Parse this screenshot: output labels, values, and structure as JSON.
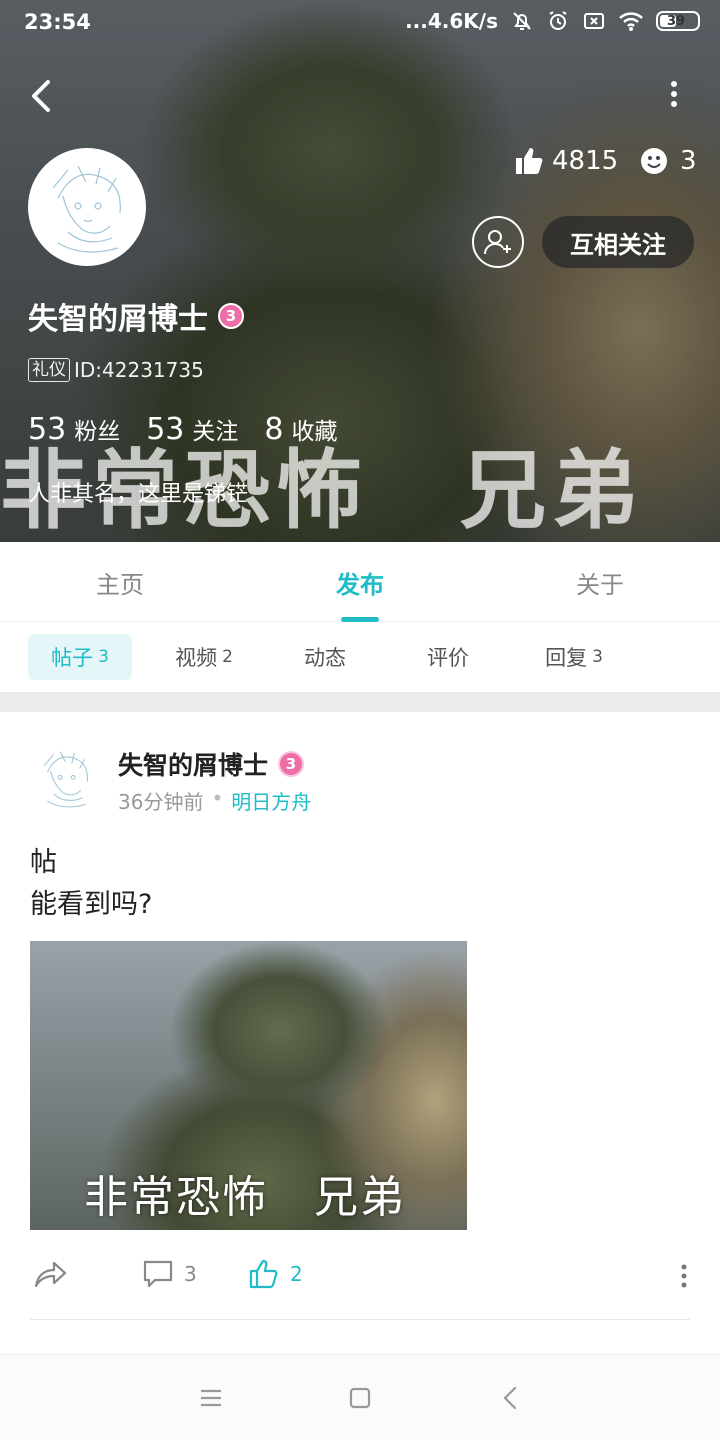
{
  "status_bar": {
    "time": "23:54",
    "network_speed": "...4.6K/s",
    "battery": "39",
    "icons": [
      "mute-bell-icon",
      "alarm-icon",
      "sim-off-icon",
      "wifi-icon",
      "battery-icon"
    ]
  },
  "header": {
    "banner_caption": "非常恐怖　兄弟",
    "likes_count": "4815",
    "smile_count": "3",
    "follow_label": "互相关注"
  },
  "profile": {
    "username": "失智的屑博士",
    "level": "3",
    "tag": "礼仪",
    "id_text": "ID:42231735",
    "fans_count": "53",
    "fans_label": "粉丝",
    "following_count": "53",
    "following_label": "关注",
    "favorites_count": "8",
    "favorites_label": "收藏",
    "bio": "人非其名，这里是锑铓"
  },
  "main_tabs": [
    {
      "label": "主页"
    },
    {
      "label": "发布"
    },
    {
      "label": "关于"
    }
  ],
  "sub_tabs": [
    {
      "label": "帖子",
      "count": "3"
    },
    {
      "label": "视频",
      "count": "2"
    },
    {
      "label": "动态",
      "count": ""
    },
    {
      "label": "评价",
      "count": ""
    },
    {
      "label": "回复",
      "count": "3"
    }
  ],
  "post": {
    "author": "失智的屑博士",
    "level": "3",
    "time": "36分钟前",
    "separator": "•",
    "board": "明日方舟",
    "title": "帖",
    "body": "能看到吗?",
    "image_caption": "非常恐怖　兄弟",
    "comments": "3",
    "likes": "2"
  },
  "colors": {
    "accent": "#1fbcc7",
    "level_badge": "#f06ea7"
  }
}
